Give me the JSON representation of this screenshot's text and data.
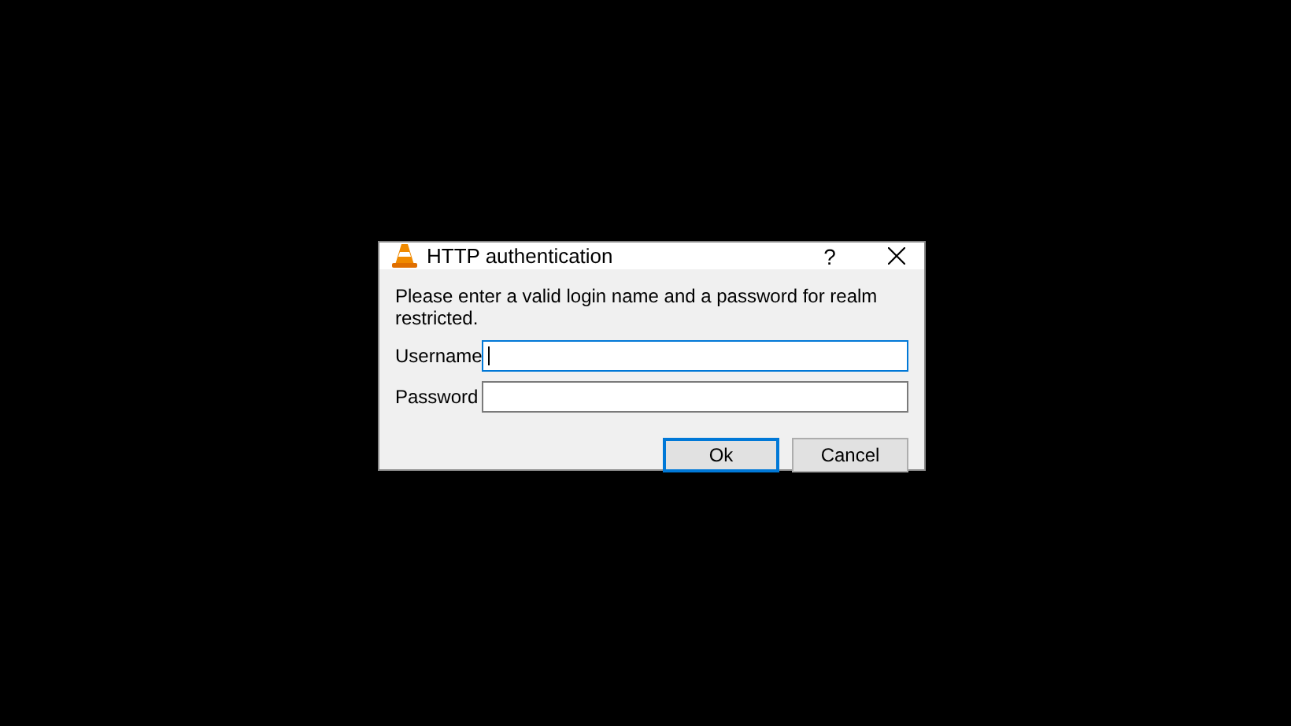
{
  "window": {
    "title": "HTTP authentication",
    "help": "?"
  },
  "message": "Please enter a valid login name and a password for realm restricted.",
  "fields": [
    {
      "label": "Username",
      "focused": true
    },
    {
      "label": "Password",
      "focused": false
    }
  ],
  "buttons": [
    {
      "label": "Ok",
      "default": true
    },
    {
      "label": "Cancel",
      "default": false
    }
  ]
}
